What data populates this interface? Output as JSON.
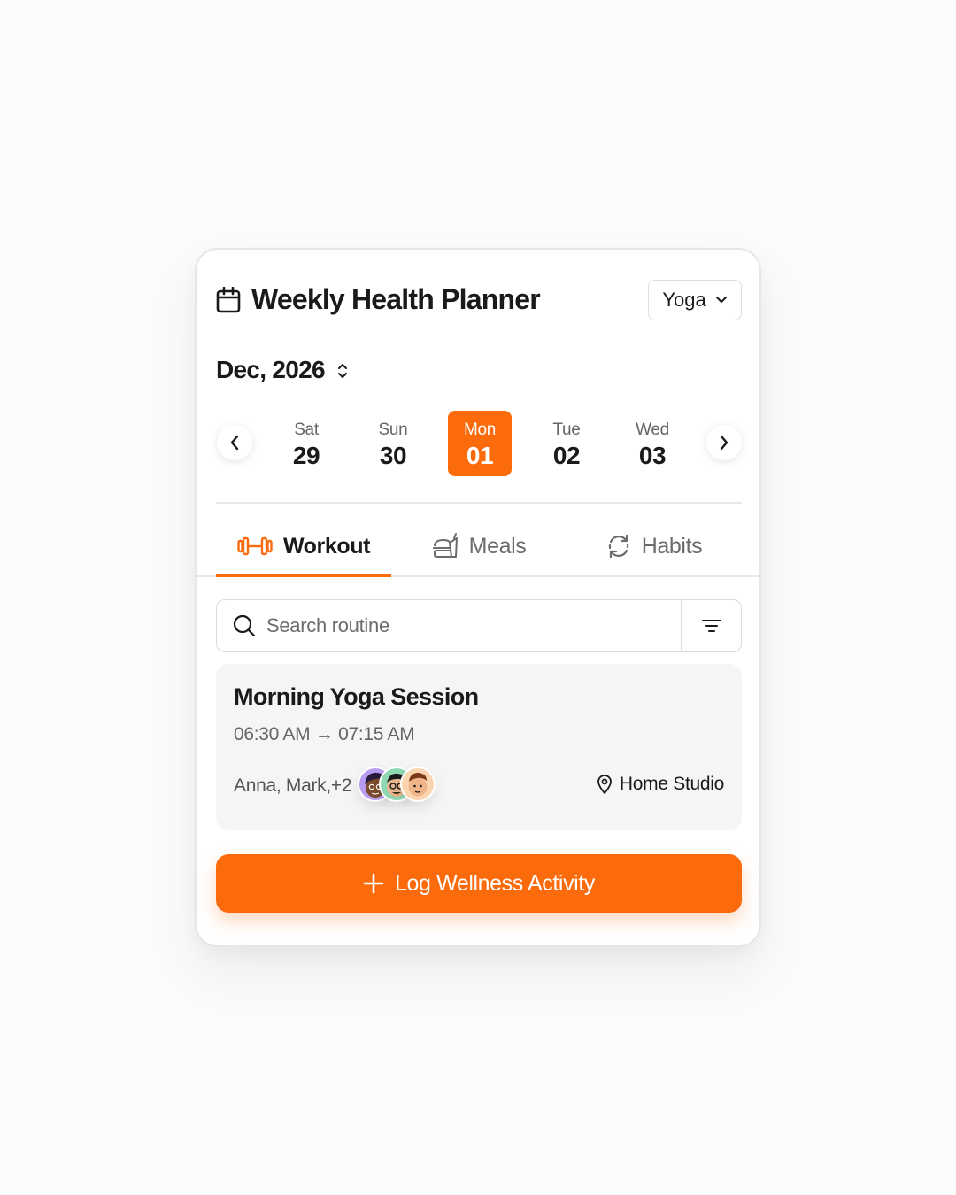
{
  "header": {
    "title": "Weekly Health Planner",
    "category_selected": "Yoga",
    "icon": "calendar-icon"
  },
  "calendar": {
    "month_label": "Dec, 2026",
    "days": [
      {
        "name": "Sat",
        "num": "29",
        "active": false
      },
      {
        "name": "Sun",
        "num": "30",
        "active": false
      },
      {
        "name": "Mon",
        "num": "01",
        "active": true
      },
      {
        "name": "Tue",
        "num": "02",
        "active": false
      },
      {
        "name": "Wed",
        "num": "03",
        "active": false
      }
    ]
  },
  "tabs": [
    {
      "label": "Workout",
      "icon": "dumbbell-icon",
      "active": true
    },
    {
      "label": "Meals",
      "icon": "food-icon",
      "active": false
    },
    {
      "label": "Habits",
      "icon": "refresh-icon",
      "active": false
    }
  ],
  "search": {
    "placeholder": "Search routine",
    "value": ""
  },
  "session": {
    "title": "Morning Yoga Session",
    "time": "06:30 AM → 07:15 AM",
    "attendees": "Anna, Mark,+2",
    "location": "Home Studio"
  },
  "cta": {
    "label": "Log Wellness Activity"
  },
  "colors": {
    "accent": "#fb6a0b",
    "text": "#1a1a1a",
    "muted": "#666666",
    "card_bg": "#f5f5f5",
    "page_bg": "#fbfbfb"
  }
}
